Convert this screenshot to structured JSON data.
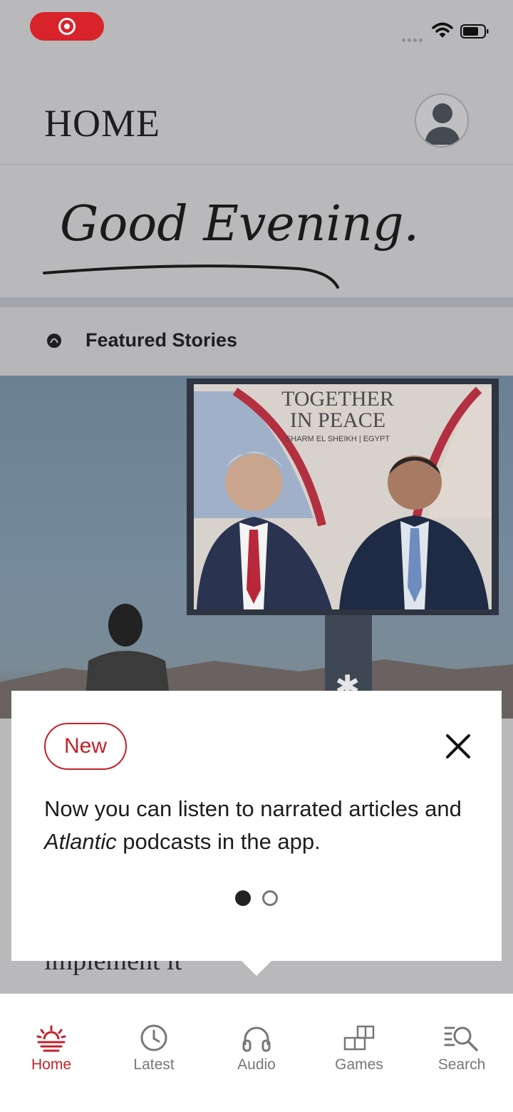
{
  "status_bar": {
    "recording_icon": "screen-record-icon",
    "signal_icon": "cellular-signal-icon",
    "wifi_icon": "wifi-icon",
    "battery_icon": "battery-icon"
  },
  "header": {
    "title": "HOME",
    "profile_icon": "account-icon"
  },
  "greeting": {
    "text": "Good Evening.",
    "style": "handwritten"
  },
  "featured": {
    "label": "Featured Stories",
    "icon": "atlantic-logo-icon"
  },
  "hero": {
    "billboard_line1": "TOGETHER",
    "billboard_line2": "IN PEACE",
    "billboard_sub": "SHARM EL SHEIKH | EGYPT"
  },
  "story_peek": "implement it",
  "popup": {
    "badge": "New",
    "message_part1": "Now you can listen to narrated articles and ",
    "message_italic": "Atlantic",
    "message_part2": " podcasts in the app.",
    "close_icon": "close-icon",
    "page_index": 1,
    "page_count": 2
  },
  "tabs": [
    {
      "label": "Home",
      "icon": "sunrise-icon",
      "active": true
    },
    {
      "label": "Latest",
      "icon": "clock-icon",
      "active": false
    },
    {
      "label": "Audio",
      "icon": "headphones-icon",
      "active": false
    },
    {
      "label": "Games",
      "icon": "grid-blocks-icon",
      "active": false
    },
    {
      "label": "Search",
      "icon": "search-icon",
      "active": false
    }
  ],
  "colors": {
    "accent": "#c3222a",
    "dim_overlay": "#b9b8bb",
    "text_dark": "#1d1d1f"
  }
}
